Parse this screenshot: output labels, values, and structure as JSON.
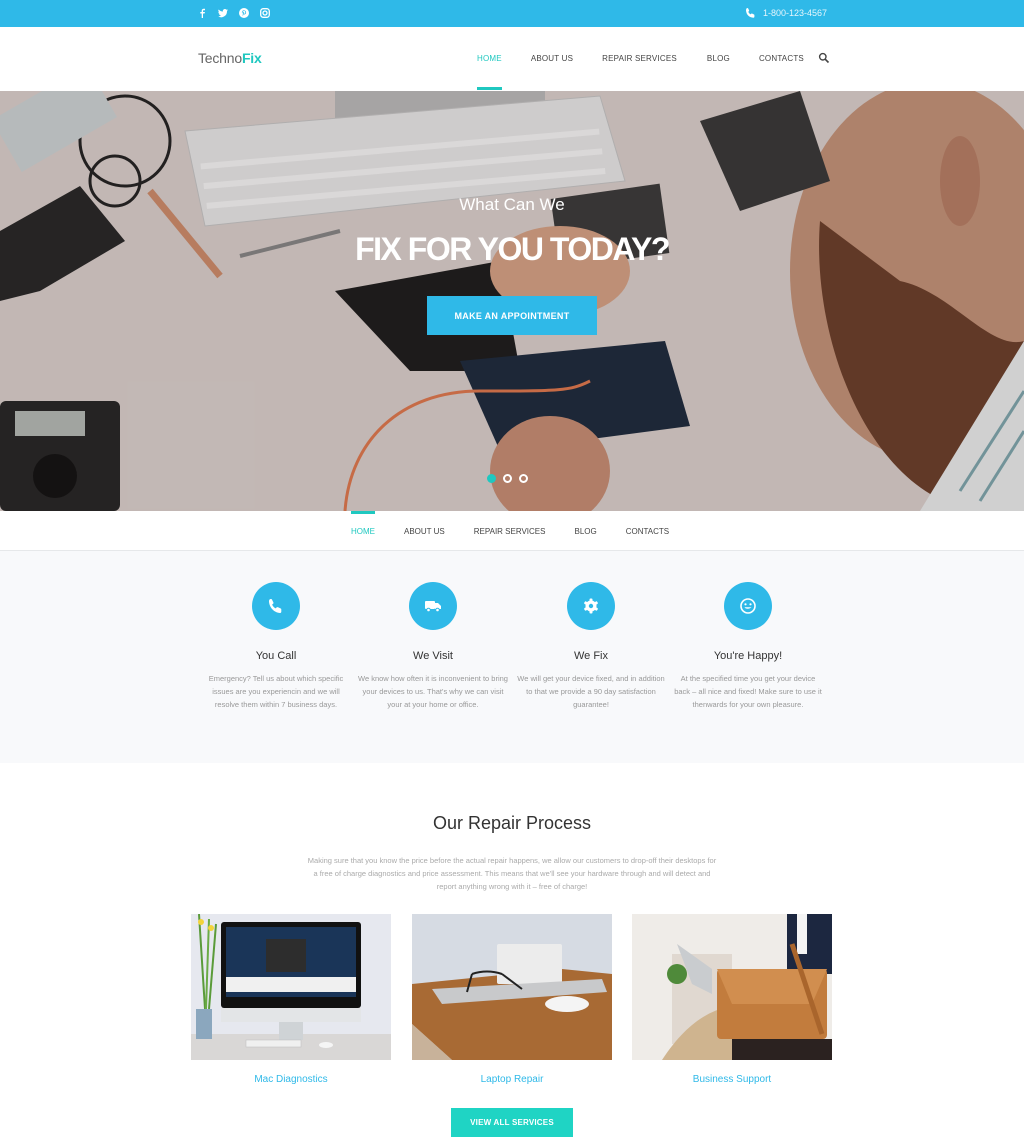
{
  "topbar": {
    "social": [
      {
        "name": "facebook-icon",
        "glyph": "f"
      },
      {
        "name": "twitter-icon",
        "glyph": "t"
      },
      {
        "name": "pinterest-icon",
        "glyph": "p"
      },
      {
        "name": "instagram-icon",
        "glyph": "i"
      }
    ],
    "phone": "1-800-123-4567"
  },
  "header": {
    "logo_part1": "Techno",
    "logo_part2": "Fix",
    "nav": [
      "HOME",
      "ABOUT US",
      "REPAIR SERVICES",
      "BLOG",
      "CONTACTS"
    ],
    "active_nav": "HOME"
  },
  "hero": {
    "subtitle": "What Can We",
    "title": "FIX FOR YOU TODAY?",
    "cta_label": "MAKE AN APPOINTMENT",
    "slides": 3,
    "active_slide": 1
  },
  "subnav": {
    "items": [
      "HOME",
      "ABOUT US",
      "REPAIR SERVICES",
      "BLOG",
      "CONTACTS"
    ]
  },
  "features": [
    {
      "icon": "phone-icon",
      "title": "You Call",
      "text": "Emergency? Tell us about which specific issues are you experiencin and we will resolve them within 7 business days."
    },
    {
      "icon": "truck-icon",
      "title": "We Visit",
      "text": "We know how often it is inconvenient to bring your devices to us. That's why we can visit your at your home or office."
    },
    {
      "icon": "gear-icon",
      "title": "We Fix",
      "text": "We will get your device fixed, and in addition to that we provide a 90 day satisfaction guarantee!"
    },
    {
      "icon": "smiley-icon",
      "title": "You're Happy!",
      "text": "At the specified time you get your device back – all nice and fixed! Make sure to use it thenwards for your own pleasure."
    }
  ],
  "process": {
    "title": "Our Repair Process",
    "text": "Making sure that you know the price before the actual repair happens, we allow our customers to drop-off their desktops for a free of charge diagnostics and price assessment. This means that we'll see your hardware through and will detect and report anything wrong with it – free of charge!",
    "cards": [
      {
        "label": "Mac Diagnostics"
      },
      {
        "label": "Laptop Repair"
      },
      {
        "label": "Business Support"
      }
    ],
    "view_all_label": "VIEW ALL SERVICES"
  },
  "colors": {
    "primary_blue": "#2fb9e8",
    "accent_teal": "#1fc8c0",
    "button_teal": "#1fd4c4"
  }
}
